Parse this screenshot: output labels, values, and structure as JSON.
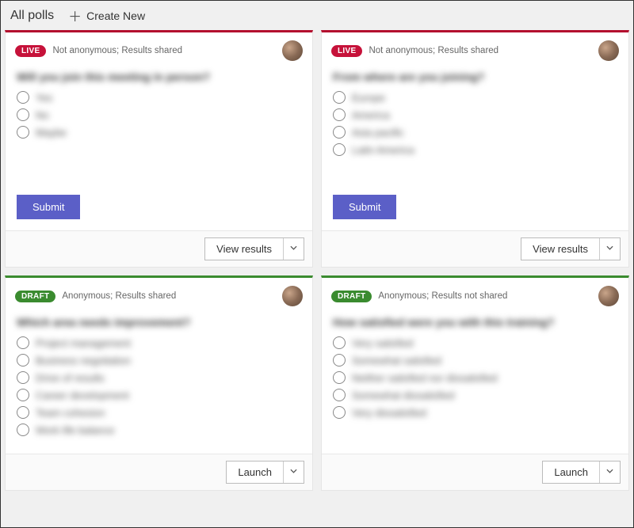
{
  "header": {
    "title": "All polls",
    "create_label": "Create New"
  },
  "badges": {
    "live": "LIVE",
    "draft": "DRAFT"
  },
  "buttons": {
    "submit": "Submit",
    "view_results": "View results",
    "launch": "Launch"
  },
  "polls": [
    {
      "status": "live",
      "meta": "Not anonymous; Results shared",
      "question": "Will you join this meeting in person?",
      "options": [
        "Yes",
        "No",
        "Maybe"
      ],
      "action": "view_results",
      "show_submit": true
    },
    {
      "status": "live",
      "meta": "Not anonymous; Results shared",
      "question": "From where are you joining?",
      "options": [
        "Europe",
        "America",
        "Asia pacific",
        "Latin America"
      ],
      "action": "view_results",
      "show_submit": true
    },
    {
      "status": "draft",
      "meta": "Anonymous; Results shared",
      "question": "Which area needs improvement?",
      "options": [
        "Project management",
        "Business negotiation",
        "Drive of results",
        "Career development",
        "Team cohesion",
        "Work life balance"
      ],
      "action": "launch",
      "show_submit": false
    },
    {
      "status": "draft",
      "meta": "Anonymous; Results not shared",
      "question": "How satisfied were you with this training?",
      "options": [
        "Very satisfied",
        "Somewhat satisfied",
        "Neither satisfied nor dissatisfied",
        "Somewhat dissatisfied",
        "Very dissatisfied"
      ],
      "action": "launch",
      "show_submit": false
    }
  ]
}
